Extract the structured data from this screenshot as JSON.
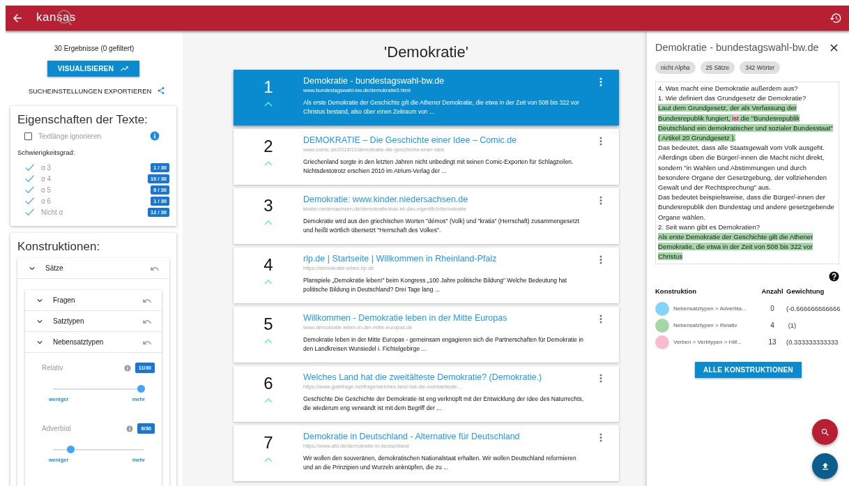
{
  "app_bar": {
    "logo": "kansas"
  },
  "sidebar": {
    "result_count": "30 Ergebnisse (0 gefiltert)",
    "visualize_button": "VISUALISIEREN",
    "export_link": "SUCHEINSTELLUNGEN EXPORTIEREN",
    "text_properties": {
      "title": "Eigenschaften der Texte:",
      "ignore_length": {
        "label": "Textlänge ignorieren",
        "checked": false
      },
      "difficulty_label": "Schwierigkeitsgrad:",
      "levels": [
        {
          "label": "α 3",
          "checked": true,
          "count": "1 / 30"
        },
        {
          "label": "α 4",
          "checked": true,
          "count": "10 / 30"
        },
        {
          "label": "α 5",
          "checked": true,
          "count": "6 / 30"
        },
        {
          "label": "α 6",
          "checked": true,
          "count": "1 / 30"
        },
        {
          "label": "Nicht α",
          "checked": true,
          "count": "12 / 30"
        }
      ]
    },
    "constructions": {
      "title": "Konstruktionen:",
      "groups": [
        {
          "label": "Sätze",
          "expanded": true,
          "children": [
            {
              "label": "Fragen",
              "expanded": false
            },
            {
              "label": "Satztypen",
              "expanded": false
            },
            {
              "label": "Nebensatztypen",
              "expanded": true,
              "sliders": [
                {
                  "label": "Relativ",
                  "count": "11/30",
                  "level": 0.97,
                  "min_label": "weniger",
                  "max_label": "mehr"
                },
                {
                  "label": "Adverbial",
                  "count": "6/30",
                  "level": 0.19,
                  "min_label": "weniger",
                  "max_label": "mehr"
                }
              ]
            }
          ]
        }
      ]
    }
  },
  "results": {
    "query": "'Demokratie'",
    "items": [
      {
        "rank": "1",
        "title": "Demokratie - bundestagswahl-bw.de",
        "url": "www.bundestagswahl-bw.de/demokratie0.html",
        "snippet": "Als erste Demokratie der Geschichte gilt die Athener Demokratie, die etwa in der Zeit von 508 bis 322 vor Christus bestand, also über einen Zeitraum von ...",
        "selected": true
      },
      {
        "rank": "2",
        "title": "DEMOKRATIE – Die Geschichte einer Idee – Comic.de",
        "url": "www.comic.de/2015/11/demokratie-die-geschichte-einer-idee",
        "snippet": "Griechenland sorgte in den letzten Jahren nicht unbedingt mit seinen Comic-Exporten für Schlagzeilen. Nichtsdestotrotz erschien 2010 im Atrium-Verlag der ...",
        "selected": false
      },
      {
        "rank": "3",
        "title": "Demokratie: www.kinder.niedersachsen.de",
        "url": "kinder.niedersachsen.de/demokratie/was-ist-das-eigentlich/demokratie",
        "snippet": "Demokratie wird aus den griechischen Worten \"démos\" (Volk) und \"kratia\" (Herrschaft) zusammengesetzt und heißt wörtlich übersetzt \"Herrschaft des Volkes\".",
        "selected": false
      },
      {
        "rank": "4",
        "title": "rlp.de | Startseite | Willkommen in Rheinland-Pfalz",
        "url": "https://demokratie-leben.rlp.de",
        "snippet": "Planspiele „Demokratie leben!\" beim Kongress „100 Jahre politische Bildung\" Welche Bedeutung hat politische Bildung in Deutschland? Drei Tage lang ...",
        "selected": false
      },
      {
        "rank": "5",
        "title": "Willkommen - Demokratie leben in der Mitte Europas",
        "url": "www.demokratie-leben-in-der-mitte-europas.de",
        "snippet": "Demokratie leben in der Mitte Europas - gemeinsam engagieren sich die Partnerschaften für Demokratie in den Landkreisen Wunsiedel i. Fichtelgebirge ...",
        "selected": false
      },
      {
        "rank": "6",
        "title": "Welches Land hat die zweitälteste Demokratie? (Demokratie.)",
        "url": "https://www.gutefrage.net/frage/welches-land-hat-die-zweitaelteste...",
        "snippet": "Geschichte Die Geschichte der Demokratie ist eng verknüpft mit der Entwicklung der Idee des Naturrechts, die wiederum eng verwandt ist mit dem Begriff der ...",
        "selected": false
      },
      {
        "rank": "7",
        "title": "Demokratie in Deutschland - Alternative für Deutschland",
        "url": "https://www.afd.de/demokratie-in-deutschland",
        "snippet": "Wir wollen den souveränen, demokratischen Nationalstaat erhalten. Wir wollen Deutschland reformieren und an die Prinzipien und Wurzeln anknüpfen, die zu ...",
        "selected": false
      }
    ]
  },
  "detail": {
    "title": "Demokratie - bundestagswahl-bw.de",
    "chips": [
      "nicht Alpha",
      "25 Sätze",
      "342 Wörter"
    ],
    "paragraphs": [
      {
        "segments": [
          {
            "text": "4. Was macht eine Demokratie außerdem aus?"
          }
        ]
      },
      {
        "segments": [
          {
            "text": "1. Wie definiert das Grundgesetz die Demokratie?"
          }
        ]
      },
      {
        "segments": [
          {
            "text": "Laut dem Grundgesetz, der als Verfassung der Bundesrepublik fungiert, ",
            "color": "#a5d6a7"
          },
          {
            "text": "ist",
            "color": "#f8bbd0"
          },
          {
            "text": " die \"Bundesrepublik Deutschland ein demokratischer und sozialer Bundesstaat\" ( Artikel 20 Grundgesetz ).",
            "color": "#a5d6a7"
          }
        ]
      },
      {
        "segments": [
          {
            "text": "Das bedeutet, dass alle Staatsgewalt vom Volk ausgeht. Allerdings üben die Bürger/-innen die Macht nicht direkt, sondern \"in Wahlen und Abstimmungen und durch besondere Organe der Gesetzgebung, der vollziehenden Gewalt und der Rechtsprechung\" aus."
          }
        ]
      },
      {
        "segments": [
          {
            "text": "Das bedeutet beispielsweise, dass die Bürger/-innen der Bundesrepublik den Bundestag und andere gesetzgebende Organe wählen."
          }
        ]
      },
      {
        "segments": [
          {
            "text": "2. Seit wann gibt es Demokratien?"
          }
        ]
      },
      {
        "segments": [
          {
            "text": "Als erste Demokratie der Geschichte gilt die Athener Demokratie, die etwa in der Zeit von 508 bis 322 vor Christus",
            "color": "#a5d6a7"
          }
        ]
      }
    ],
    "constructions_table": {
      "columns": [
        "Konstruktion",
        "Anzahl",
        "Gewichtung"
      ],
      "rows": [
        {
          "color": "#81d4fa",
          "label": "Nebensatztypen > Adverbia...",
          "count": "0",
          "weight": "(-0.666666666666"
        },
        {
          "color": "#a5d6a7",
          "label": "Nebensatztypen > Relativ",
          "count": "4",
          "weight": " (1)"
        },
        {
          "color": "#f8bbd0",
          "label": "Verben > Verbtypen > Hilf...",
          "count": "13",
          "weight": "(0.333333333333"
        }
      ]
    },
    "all_button": "ALLE KONSTRUKTIONEN"
  }
}
